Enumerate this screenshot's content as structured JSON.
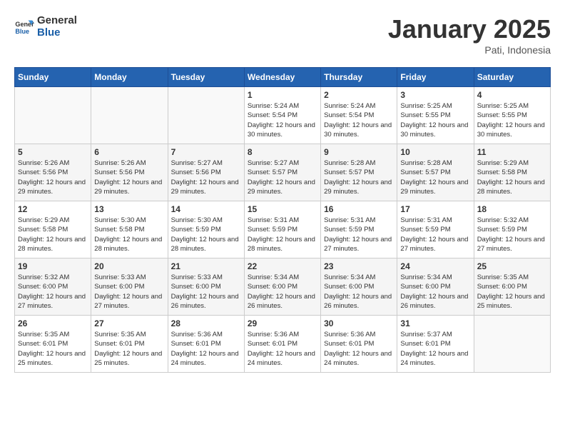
{
  "header": {
    "logo_line1": "General",
    "logo_line2": "Blue",
    "month": "January 2025",
    "location": "Pati, Indonesia"
  },
  "days_of_week": [
    "Sunday",
    "Monday",
    "Tuesday",
    "Wednesday",
    "Thursday",
    "Friday",
    "Saturday"
  ],
  "weeks": [
    [
      {
        "day": "",
        "info": ""
      },
      {
        "day": "",
        "info": ""
      },
      {
        "day": "",
        "info": ""
      },
      {
        "day": "1",
        "info": "Sunrise: 5:24 AM\nSunset: 5:54 PM\nDaylight: 12 hours and 30 minutes."
      },
      {
        "day": "2",
        "info": "Sunrise: 5:24 AM\nSunset: 5:54 PM\nDaylight: 12 hours and 30 minutes."
      },
      {
        "day": "3",
        "info": "Sunrise: 5:25 AM\nSunset: 5:55 PM\nDaylight: 12 hours and 30 minutes."
      },
      {
        "day": "4",
        "info": "Sunrise: 5:25 AM\nSunset: 5:55 PM\nDaylight: 12 hours and 30 minutes."
      }
    ],
    [
      {
        "day": "5",
        "info": "Sunrise: 5:26 AM\nSunset: 5:56 PM\nDaylight: 12 hours and 29 minutes."
      },
      {
        "day": "6",
        "info": "Sunrise: 5:26 AM\nSunset: 5:56 PM\nDaylight: 12 hours and 29 minutes."
      },
      {
        "day": "7",
        "info": "Sunrise: 5:27 AM\nSunset: 5:56 PM\nDaylight: 12 hours and 29 minutes."
      },
      {
        "day": "8",
        "info": "Sunrise: 5:27 AM\nSunset: 5:57 PM\nDaylight: 12 hours and 29 minutes."
      },
      {
        "day": "9",
        "info": "Sunrise: 5:28 AM\nSunset: 5:57 PM\nDaylight: 12 hours and 29 minutes."
      },
      {
        "day": "10",
        "info": "Sunrise: 5:28 AM\nSunset: 5:57 PM\nDaylight: 12 hours and 29 minutes."
      },
      {
        "day": "11",
        "info": "Sunrise: 5:29 AM\nSunset: 5:58 PM\nDaylight: 12 hours and 28 minutes."
      }
    ],
    [
      {
        "day": "12",
        "info": "Sunrise: 5:29 AM\nSunset: 5:58 PM\nDaylight: 12 hours and 28 minutes."
      },
      {
        "day": "13",
        "info": "Sunrise: 5:30 AM\nSunset: 5:58 PM\nDaylight: 12 hours and 28 minutes."
      },
      {
        "day": "14",
        "info": "Sunrise: 5:30 AM\nSunset: 5:59 PM\nDaylight: 12 hours and 28 minutes."
      },
      {
        "day": "15",
        "info": "Sunrise: 5:31 AM\nSunset: 5:59 PM\nDaylight: 12 hours and 28 minutes."
      },
      {
        "day": "16",
        "info": "Sunrise: 5:31 AM\nSunset: 5:59 PM\nDaylight: 12 hours and 27 minutes."
      },
      {
        "day": "17",
        "info": "Sunrise: 5:31 AM\nSunset: 5:59 PM\nDaylight: 12 hours and 27 minutes."
      },
      {
        "day": "18",
        "info": "Sunrise: 5:32 AM\nSunset: 5:59 PM\nDaylight: 12 hours and 27 minutes."
      }
    ],
    [
      {
        "day": "19",
        "info": "Sunrise: 5:32 AM\nSunset: 6:00 PM\nDaylight: 12 hours and 27 minutes."
      },
      {
        "day": "20",
        "info": "Sunrise: 5:33 AM\nSunset: 6:00 PM\nDaylight: 12 hours and 27 minutes."
      },
      {
        "day": "21",
        "info": "Sunrise: 5:33 AM\nSunset: 6:00 PM\nDaylight: 12 hours and 26 minutes."
      },
      {
        "day": "22",
        "info": "Sunrise: 5:34 AM\nSunset: 6:00 PM\nDaylight: 12 hours and 26 minutes."
      },
      {
        "day": "23",
        "info": "Sunrise: 5:34 AM\nSunset: 6:00 PM\nDaylight: 12 hours and 26 minutes."
      },
      {
        "day": "24",
        "info": "Sunrise: 5:34 AM\nSunset: 6:00 PM\nDaylight: 12 hours and 26 minutes."
      },
      {
        "day": "25",
        "info": "Sunrise: 5:35 AM\nSunset: 6:00 PM\nDaylight: 12 hours and 25 minutes."
      }
    ],
    [
      {
        "day": "26",
        "info": "Sunrise: 5:35 AM\nSunset: 6:01 PM\nDaylight: 12 hours and 25 minutes."
      },
      {
        "day": "27",
        "info": "Sunrise: 5:35 AM\nSunset: 6:01 PM\nDaylight: 12 hours and 25 minutes."
      },
      {
        "day": "28",
        "info": "Sunrise: 5:36 AM\nSunset: 6:01 PM\nDaylight: 12 hours and 24 minutes."
      },
      {
        "day": "29",
        "info": "Sunrise: 5:36 AM\nSunset: 6:01 PM\nDaylight: 12 hours and 24 minutes."
      },
      {
        "day": "30",
        "info": "Sunrise: 5:36 AM\nSunset: 6:01 PM\nDaylight: 12 hours and 24 minutes."
      },
      {
        "day": "31",
        "info": "Sunrise: 5:37 AM\nSunset: 6:01 PM\nDaylight: 12 hours and 24 minutes."
      },
      {
        "day": "",
        "info": ""
      }
    ]
  ]
}
